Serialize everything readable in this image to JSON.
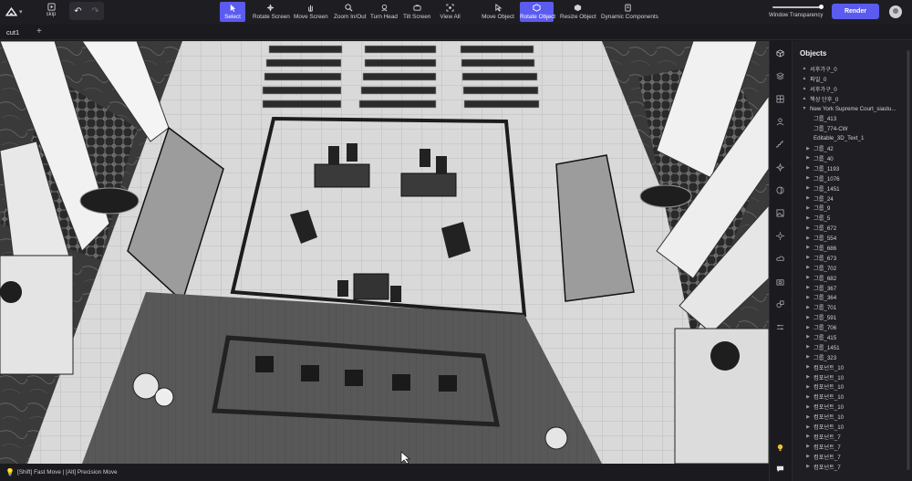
{
  "toolbar": {
    "skip_label": "skip",
    "undo_caption": "     ",
    "tools": [
      {
        "label": "Select",
        "icon": "cursor-icon",
        "active": true
      },
      {
        "label": "Rotate Screen",
        "icon": "rotate-screen-icon",
        "active": false
      },
      {
        "label": "Move Screen",
        "icon": "hand-icon",
        "active": false
      },
      {
        "label": "Zoom In/Out",
        "icon": "zoom-icon",
        "active": false
      },
      {
        "label": "Turn Head",
        "icon": "head-icon",
        "active": false
      },
      {
        "label": "Tilt Screen",
        "icon": "tilt-icon",
        "active": false
      },
      {
        "label": "View All",
        "icon": "view-all-icon",
        "active": false
      },
      {
        "label": "Move Object",
        "icon": "move-object-icon",
        "active": false
      },
      {
        "label": "Rotate Object",
        "icon": "rotate-object-icon",
        "active": true
      },
      {
        "label": "Resize Object",
        "icon": "resize-object-icon",
        "active": false
      },
      {
        "label": "Dynamic Components",
        "icon": "dynamic-components-icon",
        "active": false
      }
    ],
    "transparency_label": "Window Transparency",
    "transparency_value": 1.0,
    "render_label": "Render",
    "accent_color": "#5b5bf0"
  },
  "tabs": {
    "active": "cut1",
    "add_label": "+"
  },
  "status": {
    "hint": "[Shift] Fast Move | [Alt] Precision Move"
  },
  "rail_icons": [
    "cube-icon",
    "layers-icon",
    "grid-icon",
    "person-icon",
    "stairs-icon",
    "sparkle-icon",
    "sphere-icon",
    "image-icon",
    "sun-icon",
    "cloud-icon",
    "camera-icon",
    "shapes-icon",
    "sliders-icon",
    "lightbulb-icon",
    "chat-icon"
  ],
  "objects_panel": {
    "title": "Objects",
    "items": [
      {
        "label": "서후가구_0",
        "depth": 1,
        "arrow": "▲"
      },
      {
        "label": "파일_0",
        "depth": 1,
        "arrow": "▲"
      },
      {
        "label": "서후가구_0",
        "depth": 1,
        "arrow": "▲"
      },
      {
        "label": "책상 단후_0",
        "depth": 1,
        "arrow": "▲"
      },
      {
        "label": "New York Supreme Court_siastu...",
        "depth": 1,
        "arrow": "▼"
      },
      {
        "label": "그룹_413",
        "depth": 2,
        "arrow": ""
      },
      {
        "label": "그룹_774-CW",
        "depth": 2,
        "arrow": ""
      },
      {
        "label": "Editable_3D_Text_1",
        "depth": 2,
        "arrow": ""
      },
      {
        "label": "그룹_42",
        "depth": 2,
        "arrow": "▶"
      },
      {
        "label": "그룹_40",
        "depth": 2,
        "arrow": "▶"
      },
      {
        "label": "그룹_1193",
        "depth": 2,
        "arrow": "▶"
      },
      {
        "label": "그룹_1076",
        "depth": 2,
        "arrow": "▶"
      },
      {
        "label": "그룹_1451",
        "depth": 2,
        "arrow": "▶"
      },
      {
        "label": "그룹_24",
        "depth": 2,
        "arrow": "▶"
      },
      {
        "label": "그룹_9",
        "depth": 2,
        "arrow": "▶"
      },
      {
        "label": "그룹_5",
        "depth": 2,
        "arrow": "▶"
      },
      {
        "label": "그룹_672",
        "depth": 2,
        "arrow": "▶"
      },
      {
        "label": "그룹_554",
        "depth": 2,
        "arrow": "▶"
      },
      {
        "label": "그룹_686",
        "depth": 2,
        "arrow": "▶"
      },
      {
        "label": "그룹_673",
        "depth": 2,
        "arrow": "▶"
      },
      {
        "label": "그룹_702",
        "depth": 2,
        "arrow": "▶"
      },
      {
        "label": "그룹_682",
        "depth": 2,
        "arrow": "▶"
      },
      {
        "label": "그룹_367",
        "depth": 2,
        "arrow": "▶"
      },
      {
        "label": "그룹_364",
        "depth": 2,
        "arrow": "▶"
      },
      {
        "label": "그룹_701",
        "depth": 2,
        "arrow": "▶"
      },
      {
        "label": "그룹_591",
        "depth": 2,
        "arrow": "▶"
      },
      {
        "label": "그룹_706",
        "depth": 2,
        "arrow": "▶"
      },
      {
        "label": "그룹_415",
        "depth": 2,
        "arrow": "▶"
      },
      {
        "label": "그룹_1451",
        "depth": 2,
        "arrow": "▶"
      },
      {
        "label": "그룹_323",
        "depth": 2,
        "arrow": "▶"
      },
      {
        "label": "컴포넌트_10",
        "depth": 2,
        "arrow": "▶"
      },
      {
        "label": "컴포넌트_10",
        "depth": 2,
        "arrow": "▶"
      },
      {
        "label": "컴포넌트_10",
        "depth": 2,
        "arrow": "▶"
      },
      {
        "label": "컴포넌트_10",
        "depth": 2,
        "arrow": "▶"
      },
      {
        "label": "컴포넌트_10",
        "depth": 2,
        "arrow": "▶"
      },
      {
        "label": "컴포넌트_10",
        "depth": 2,
        "arrow": "▶"
      },
      {
        "label": "컴포넌트_10",
        "depth": 2,
        "arrow": "▶"
      },
      {
        "label": "컴포넌트_7",
        "depth": 2,
        "arrow": "▶"
      },
      {
        "label": "컴포넌트_7",
        "depth": 2,
        "arrow": "▶"
      },
      {
        "label": "컴포넌트_7",
        "depth": 2,
        "arrow": "▶"
      },
      {
        "label": "컴포넌트_7",
        "depth": 2,
        "arrow": "▶"
      }
    ]
  }
}
